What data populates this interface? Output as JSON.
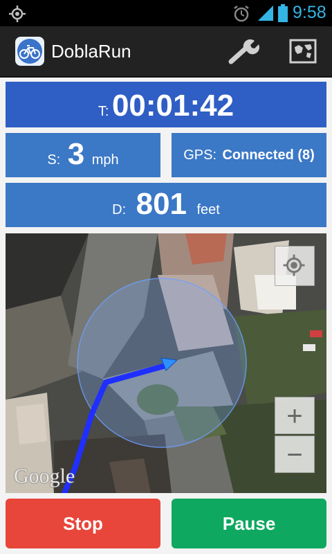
{
  "status_bar": {
    "time": "9:58",
    "icons": [
      "gps-icon",
      "alarm-icon",
      "signal-icon",
      "battery-icon"
    ],
    "accent_color": "#33b5e5"
  },
  "action_bar": {
    "title": "DoblaRun",
    "icons": [
      "bicycle-app-icon",
      "wrench-settings-icon",
      "map-icon"
    ]
  },
  "time_panel": {
    "label": "T:",
    "value": "00:01:42"
  },
  "speed_panel": {
    "label": "S:",
    "value": "3",
    "unit": "mph"
  },
  "gps_panel": {
    "label": "GPS:",
    "value": "Connected (8)"
  },
  "distance_panel": {
    "label": "D:",
    "value": "801",
    "unit": "feet"
  },
  "map": {
    "zoom_in": "+",
    "zoom_out": "−",
    "attribution": "Google",
    "icons": [
      "my-location-icon"
    ]
  },
  "buttons": {
    "stop": "Stop",
    "pause": "Pause"
  },
  "colors": {
    "time_panel": "#2f5ec4",
    "panel": "#3b78c6",
    "stop": "#e8463a",
    "pause": "#0fa860"
  }
}
